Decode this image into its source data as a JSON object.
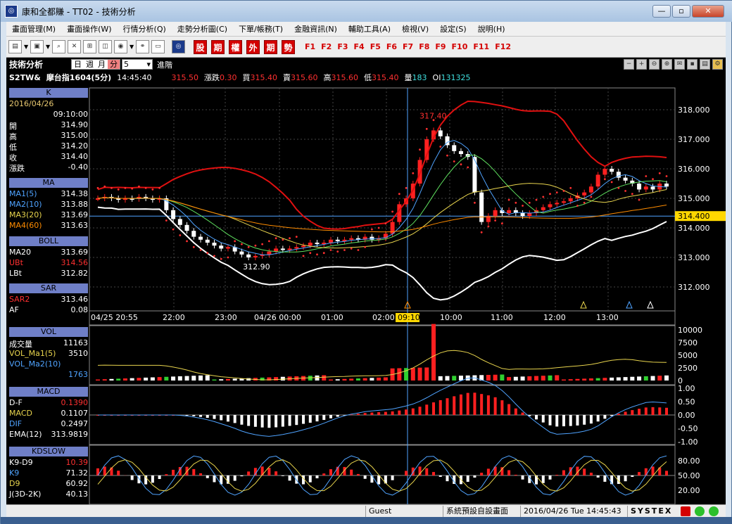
{
  "window": {
    "title": "康和全都賺 - TT02 - 技術分析",
    "min": "—",
    "max": "▫",
    "close": "✕"
  },
  "menu": [
    "畫面管理(M)",
    "畫面操作(W)",
    "行情分析(Q)",
    "走勢分析圖(C)",
    "下單/帳務(T)",
    "金融資訊(N)",
    "輔助工具(A)",
    "檢視(V)",
    "設定(S)",
    "說明(H)"
  ],
  "toolbar": {
    "cn_buttons": [
      "股",
      "期",
      "權",
      "外",
      "期",
      "勢"
    ],
    "fkeys": [
      "F1",
      "F2",
      "F3",
      "F4",
      "F5",
      "F6",
      "F7",
      "F8",
      "F9",
      "F10",
      "F11",
      "F12"
    ]
  },
  "chart_header": {
    "title": "技術分析",
    "periods": [
      "日",
      "週",
      "月",
      "分"
    ],
    "active_period": "分",
    "interval": "5",
    "advanced": "進階"
  },
  "quote": {
    "symbol": "S2TW&",
    "name": "摩台指1604(5分)",
    "time": "14:45:40",
    "price": "315.50",
    "chg_label": "漲跌",
    "chg": "0.30",
    "bid_label": "買",
    "bid": "315.40",
    "ask_label": "賣",
    "ask": "315.60",
    "high_label": "高",
    "high": "315.60",
    "low_label": "低",
    "low": "315.40",
    "vol_label": "量",
    "vol": "183",
    "oi_label": "OI",
    "oi": "131325"
  },
  "panel_k": {
    "title": "K",
    "date": "2016/04/26",
    "time": "09:10:00",
    "open_l": "開",
    "open": "314.90",
    "high_l": "高",
    "high": "315.00",
    "low_l": "低",
    "low": "314.20",
    "close_l": "收",
    "close": "314.40",
    "chg_l": "漲跌",
    "chg": "-0.40"
  },
  "panel_ma": {
    "title": "MA",
    "ma1_l": "MA1(5)",
    "ma1": "314.38",
    "ma2_l": "MA2(10)",
    "ma2": "313.88",
    "ma3_l": "MA3(20)",
    "ma3": "313.69",
    "ma4_l": "MA4(60)",
    "ma4": "313.63"
  },
  "panel_boll": {
    "title": "BOLL",
    "ma20_l": "MA20",
    "ma20": "313.69",
    "ubt_l": "UBt",
    "ubt": "314.56",
    "lbt_l": "LBt",
    "lbt": "312.82"
  },
  "panel_sar": {
    "title": "SAR",
    "sar_l": "SAR2",
    "sar": "313.46",
    "af_l": "AF",
    "af": "0.08"
  },
  "panel_vol": {
    "title": "VOL",
    "v_l": "成交量",
    "v": "11163",
    "ma1_l": "VOL_Ma1(5)",
    "ma1": "3510",
    "ma2_l": "VOL_Ma2(10)",
    "ma2": "1763"
  },
  "panel_macd": {
    "title": "MACD",
    "df_l": "D-F",
    "df": "0.1390",
    "macd_l": "MACD",
    "macd": "0.1107",
    "dif_l": "DIF",
    "dif": "0.2497",
    "ema_l": "EMA(12)",
    "ema": "313.9819"
  },
  "panel_kd": {
    "title": "KDSLOW",
    "kd_l": "K9-D9",
    "kd": "10.39",
    "k_l": "K9",
    "k": "71.32",
    "d_l": "D9",
    "d": "60.92",
    "j_l": "J(3D-2K)",
    "j": "40.13"
  },
  "price_axis": [
    "318.000",
    "317.000",
    "316.000",
    "315.000",
    "314.000",
    "313.000",
    "312.000"
  ],
  "price_cursor": "314.400",
  "annotations": {
    "high": "317.40",
    "low": "312.90"
  },
  "time_axis": [
    "04/25 20:55",
    "22:00",
    "23:00",
    "04/26 00:00",
    "01:00",
    "02:00",
    "10:00",
    "11:00",
    "12:00",
    "13:00"
  ],
  "time_cursor": "09:10",
  "vol_axis": [
    "10000",
    "7500",
    "5000",
    "2500",
    "0"
  ],
  "macd_axis": [
    "1.00",
    "0.50",
    "0.00",
    "-0.50",
    "-1.00"
  ],
  "kd_axis": [
    "80.00",
    "50.00",
    "20.00"
  ],
  "status": {
    "user": "Guest",
    "layout": "系統預設自設畫面",
    "datetime": "2016/04/26 Tue 14:45:43",
    "brand": "SYSTEX"
  },
  "colors": {
    "up": "#ff2020",
    "down": "#ffffff",
    "boll": "#e01010",
    "sar": "#ff3030",
    "ma1": "#4fa3ff",
    "ma3": "#e8d44d",
    "ma4": "#ff8c00",
    "panel": "#6f7fc7"
  }
}
